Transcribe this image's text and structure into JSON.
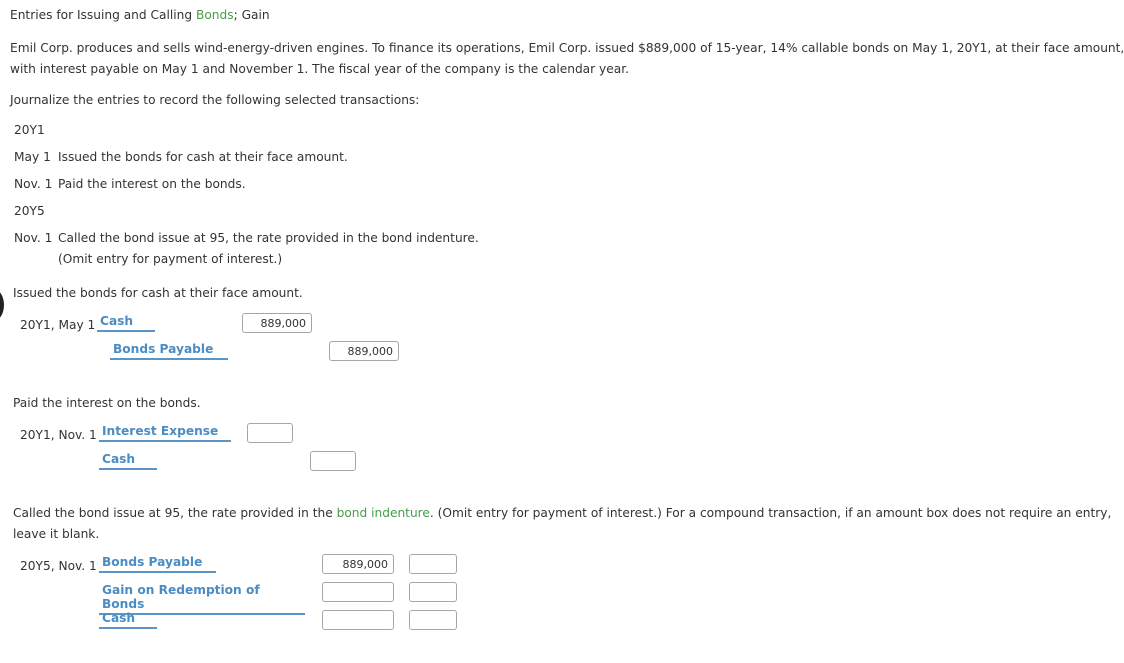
{
  "title": {
    "prefix": "Entries for Issuing and Calling ",
    "link": "Bonds",
    "suffix": "; Gain"
  },
  "intro": {
    "line1": "Emil Corp. produces and sells wind-energy-driven engines. To finance its operations, Emil Corp. issued $889,000 of 15-year, 14% callable bonds on May 1, 20Y1, at their face amount,",
    "line2": "with interest payable on May 1 and November 1. The fiscal year of the company is the calendar year."
  },
  "instruction": "Journalize the entries to record the following selected transactions:",
  "transactions": {
    "year1": "20Y1",
    "t1_date": "May 1",
    "t1_text": "Issued the bonds for cash at their face amount.",
    "t2_date": "Nov. 1",
    "t2_text": "Paid the interest on the bonds.",
    "year2": "20Y5",
    "t3_date": "Nov. 1",
    "t3_text": "Called the bond issue at 95, the rate provided in the bond indenture.",
    "t3_note": "(Omit entry for payment of interest.)"
  },
  "entry1": {
    "heading": "Issued the bonds for cash at their face amount.",
    "date": "20Y1, May 1",
    "rows": [
      {
        "account": "Cash",
        "debit": "889,000",
        "credit": ""
      },
      {
        "account": "Bonds Payable",
        "debit": "",
        "credit": "889,000"
      }
    ]
  },
  "entry2": {
    "heading": "Paid the interest on the bonds.",
    "date": "20Y1, Nov. 1",
    "rows": [
      {
        "account": "Interest Expense",
        "debit": "",
        "credit": ""
      },
      {
        "account": "Cash",
        "debit": "",
        "credit": ""
      }
    ]
  },
  "entry3": {
    "heading_prefix": "Called the bond issue at 95, the rate provided in the ",
    "heading_link": "bond indenture",
    "heading_suffix": ". (Omit entry for payment of interest.) For a compound transaction, if an amount box does not require an entry,",
    "heading_line2": "leave it blank.",
    "date": "20Y5, Nov. 1",
    "rows": [
      {
        "account": "Bonds Payable",
        "debit": "889,000",
        "credit": ""
      },
      {
        "account": "Gain on Redemption of Bonds",
        "debit": "",
        "credit": ""
      },
      {
        "account": "Cash",
        "debit": "",
        "credit": ""
      }
    ]
  }
}
